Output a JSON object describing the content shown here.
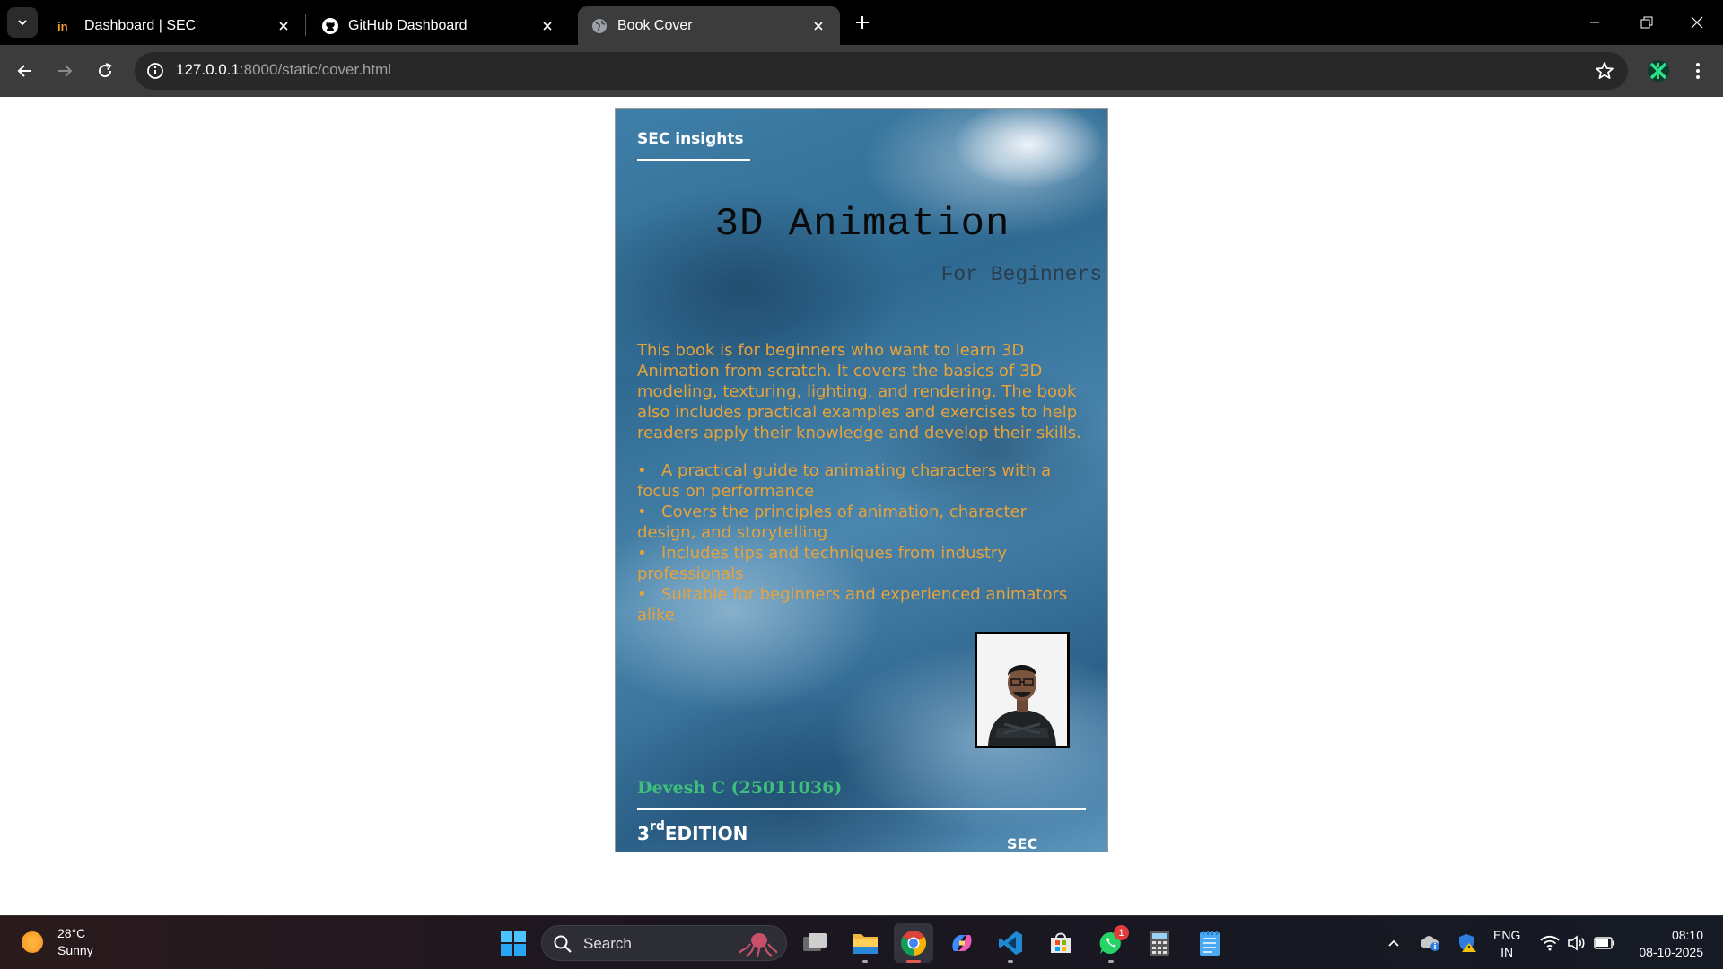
{
  "browser": {
    "tabs": [
      {
        "title": "Dashboard | SEC"
      },
      {
        "title": "GitHub Dashboard"
      },
      {
        "title": "Book Cover"
      }
    ],
    "url": {
      "host": "127.0.0.1",
      "path": ":8000/static/cover.html"
    }
  },
  "cover": {
    "brand": "SEC insights",
    "title": "3D Animation",
    "subtitle": "For Beginners",
    "description": "This book is for beginners who want to learn 3D Animation from scratch. It covers the basics of 3D modeling, texturing, lighting, and rendering. The book also includes practical examples and exercises to help readers apply their knowledge and develop their skills.",
    "features": [
      "A practical guide to animating characters with a focus on performance",
      "Covers the principles of animation, character design, and storytelling",
      "Includes tips and techniques from industry professionals",
      "Suitable for beginners and experienced animators alike"
    ],
    "author": "Devesh C (25011036)",
    "edition_number": "3",
    "edition_suffix": "rd",
    "edition_label": "EDITION",
    "publisher": "SEC",
    "colors": {
      "body_text": "#e8a23a",
      "author": "#3ec07a"
    }
  },
  "taskbar": {
    "weather": {
      "temp": "28°C",
      "condition": "Sunny"
    },
    "search_label": "Search",
    "whatsapp_badge": "1",
    "language": {
      "lang": "ENG",
      "region": "IN"
    },
    "clock": {
      "time": "08:10",
      "date": "08-10-2025"
    }
  }
}
